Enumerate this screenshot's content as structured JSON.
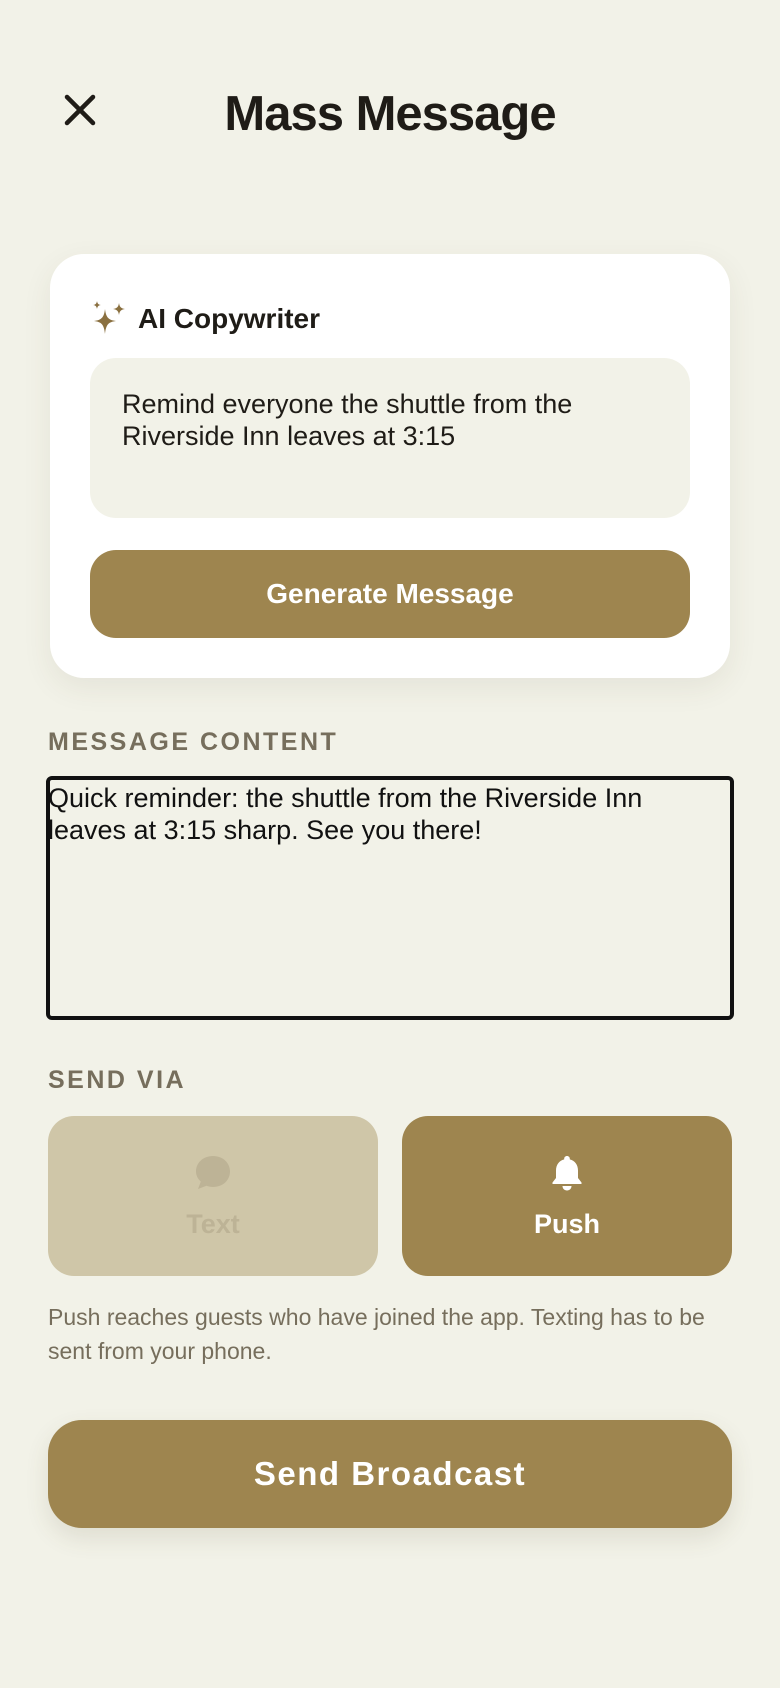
{
  "header": {
    "title": "Mass Message",
    "close_icon": "close-icon"
  },
  "ai_copywriter": {
    "title": "AI Copywriter",
    "icon": "sparkle-icon",
    "prompt_value": "Remind everyone the shuttle from the Riverside Inn leaves at 3:15",
    "generate_label": "Generate Message"
  },
  "message_content": {
    "label": "MESSAGE CONTENT",
    "value": "Quick reminder: the shuttle from the Riverside Inn leaves at 3:15 sharp. See you there!"
  },
  "send_via": {
    "label": "SEND VIA",
    "options": [
      {
        "label": "Text",
        "icon": "chat-bubble-icon",
        "selected": false
      },
      {
        "label": "Push",
        "icon": "bell-icon",
        "selected": true
      }
    ],
    "helper": "Push reaches guests who have joined the app. Texting has to be sent from your phone."
  },
  "send_button": {
    "label": "Send Broadcast"
  },
  "colors": {
    "background": "#f2f2e8",
    "accent": "#9e854f",
    "muted_option": "#cfc6a8",
    "muted_text": "#766e5c"
  }
}
